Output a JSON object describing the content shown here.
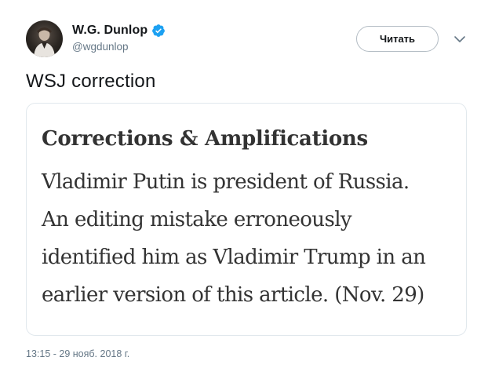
{
  "author": {
    "display_name": "W.G. Dunlop",
    "handle": "@wgdunlop",
    "verified": true
  },
  "follow_button": {
    "label": "Читать"
  },
  "tweet": {
    "text": "WSJ correction",
    "timestamp": "13:15 - 29 нояб. 2018 г."
  },
  "card": {
    "heading": "Corrections & Amplifications",
    "lines": [
      "Vladimir Putin is president of Russia.",
      "An editing mistake erroneously",
      "identified him as Vladimir Trump in an",
      "earlier version of this article. (Nov. 29)"
    ]
  },
  "colors": {
    "verified_blue": "#1da1f2",
    "secondary_text": "#657786",
    "card_border": "#e1e8ed",
    "card_text": "#333333"
  },
  "icons": {
    "verified": "verified-badge-icon",
    "caret": "chevron-down-icon"
  }
}
